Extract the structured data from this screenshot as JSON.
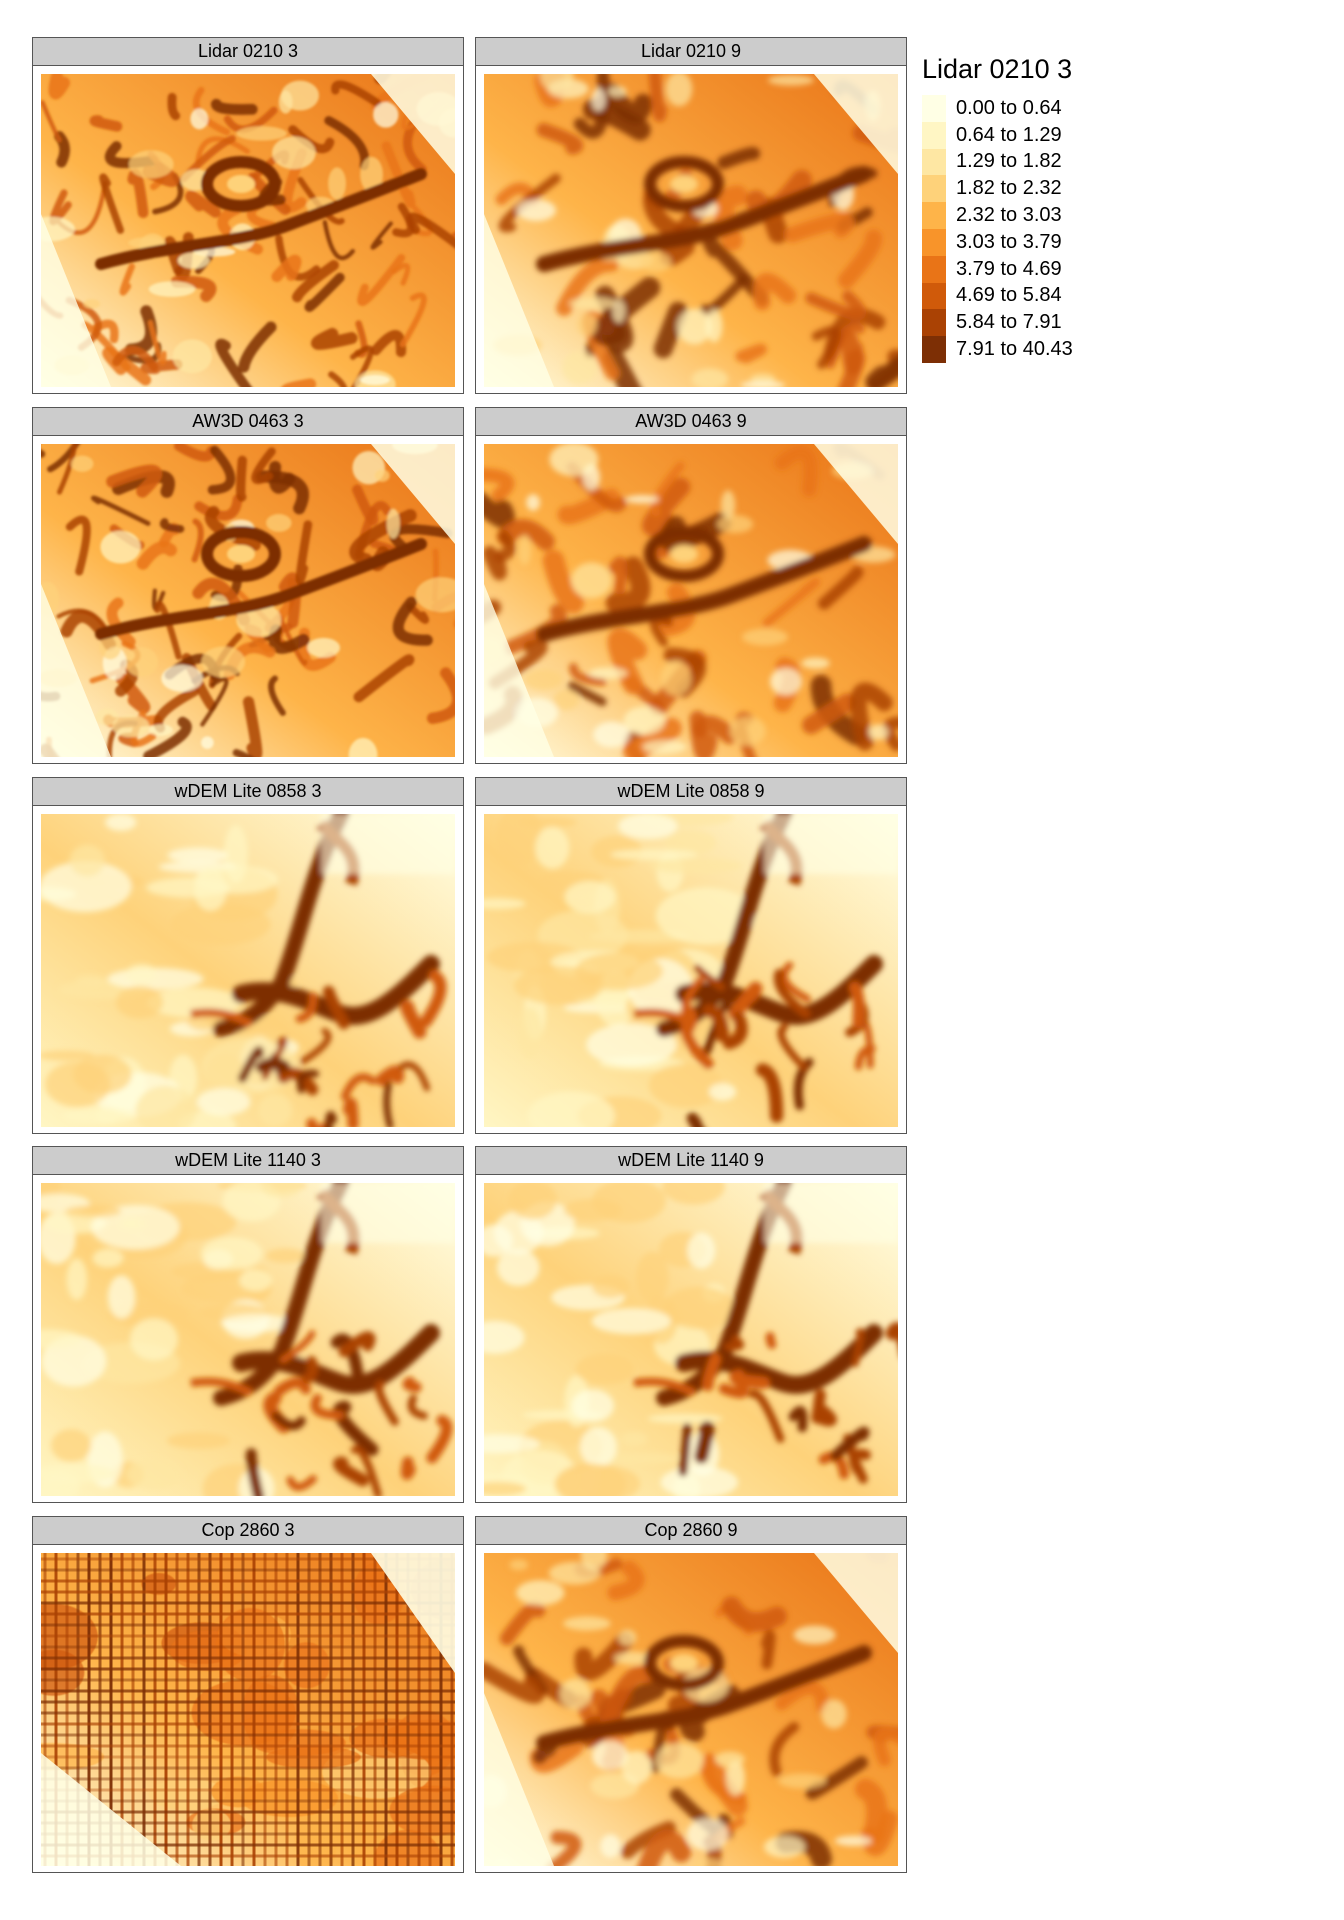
{
  "legend": {
    "title": "Lidar 0210 3",
    "classes": [
      {
        "label": "0.00 to 0.64",
        "color": "#FFFFE5"
      },
      {
        "label": "0.64 to 1.29",
        "color": "#FFF6C4"
      },
      {
        "label": "1.29 to 1.82",
        "color": "#FEE7A3"
      },
      {
        "label": "1.82 to 2.32",
        "color": "#FED27A"
      },
      {
        "label": "2.32 to 3.03",
        "color": "#FEB449"
      },
      {
        "label": "3.03 to 3.79",
        "color": "#F8942A"
      },
      {
        "label": "3.79 to 4.69",
        "color": "#E97417"
      },
      {
        "label": "4.69 to 5.84",
        "color": "#D05A0A"
      },
      {
        "label": "5.84 to 7.91",
        "color": "#AA4204"
      },
      {
        "label": "7.91 to 40.43",
        "color": "#7D2F05"
      }
    ]
  },
  "panels": [
    {
      "title": "Lidar 0210 3",
      "style": "fine"
    },
    {
      "title": "Lidar 0210 9",
      "style": "smooth"
    },
    {
      "title": "AW3D 0463 3",
      "style": "fine"
    },
    {
      "title": "AW3D 0463 9",
      "style": "smooth"
    },
    {
      "title": "wDEM Lite 0858 3",
      "style": "light"
    },
    {
      "title": "wDEM Lite 0858 9",
      "style": "light"
    },
    {
      "title": "wDEM Lite 1140 3",
      "style": "light"
    },
    {
      "title": "wDEM Lite 1140 9",
      "style": "light"
    },
    {
      "title": "Cop 2860 3",
      "style": "grid"
    },
    {
      "title": "Cop 2860 9",
      "style": "smooth"
    }
  ]
}
